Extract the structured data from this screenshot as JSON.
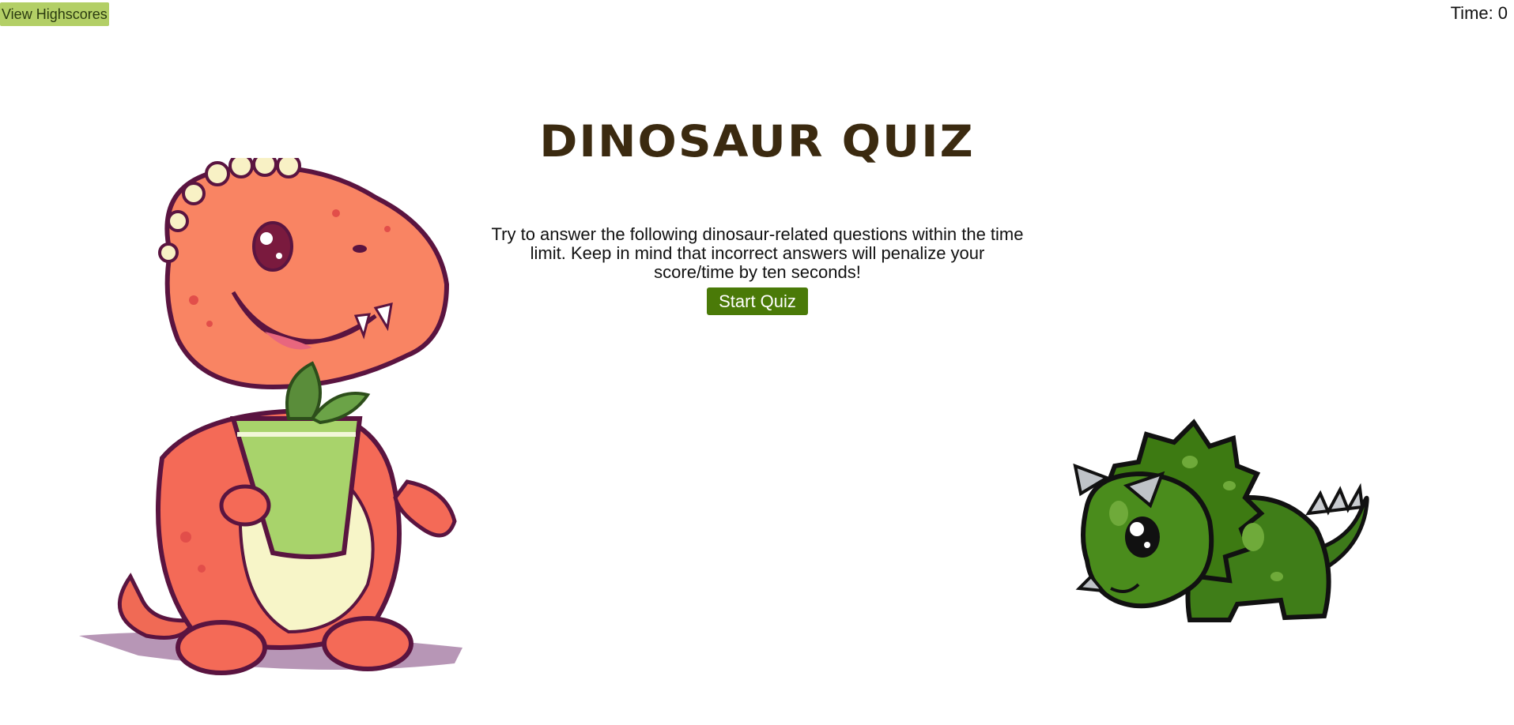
{
  "header": {
    "highscores_label": "View Highscores",
    "time_label": "Time:",
    "time_value": "0"
  },
  "main": {
    "title": "Dinosaur Quiz",
    "description": "Try to answer the following dinosaur-related questions within the time limit. Keep in mind that incorrect answers will penalize your score/time by ten seconds!",
    "start_label": "Start Quiz"
  },
  "images": {
    "left": "orange-dinosaur-with-drink-illustration",
    "right": "green-triceratops-illustration"
  },
  "colors": {
    "highscores_bg": "#b3cf66",
    "start_bg": "#4a7a08",
    "title": "#3b2a10"
  }
}
